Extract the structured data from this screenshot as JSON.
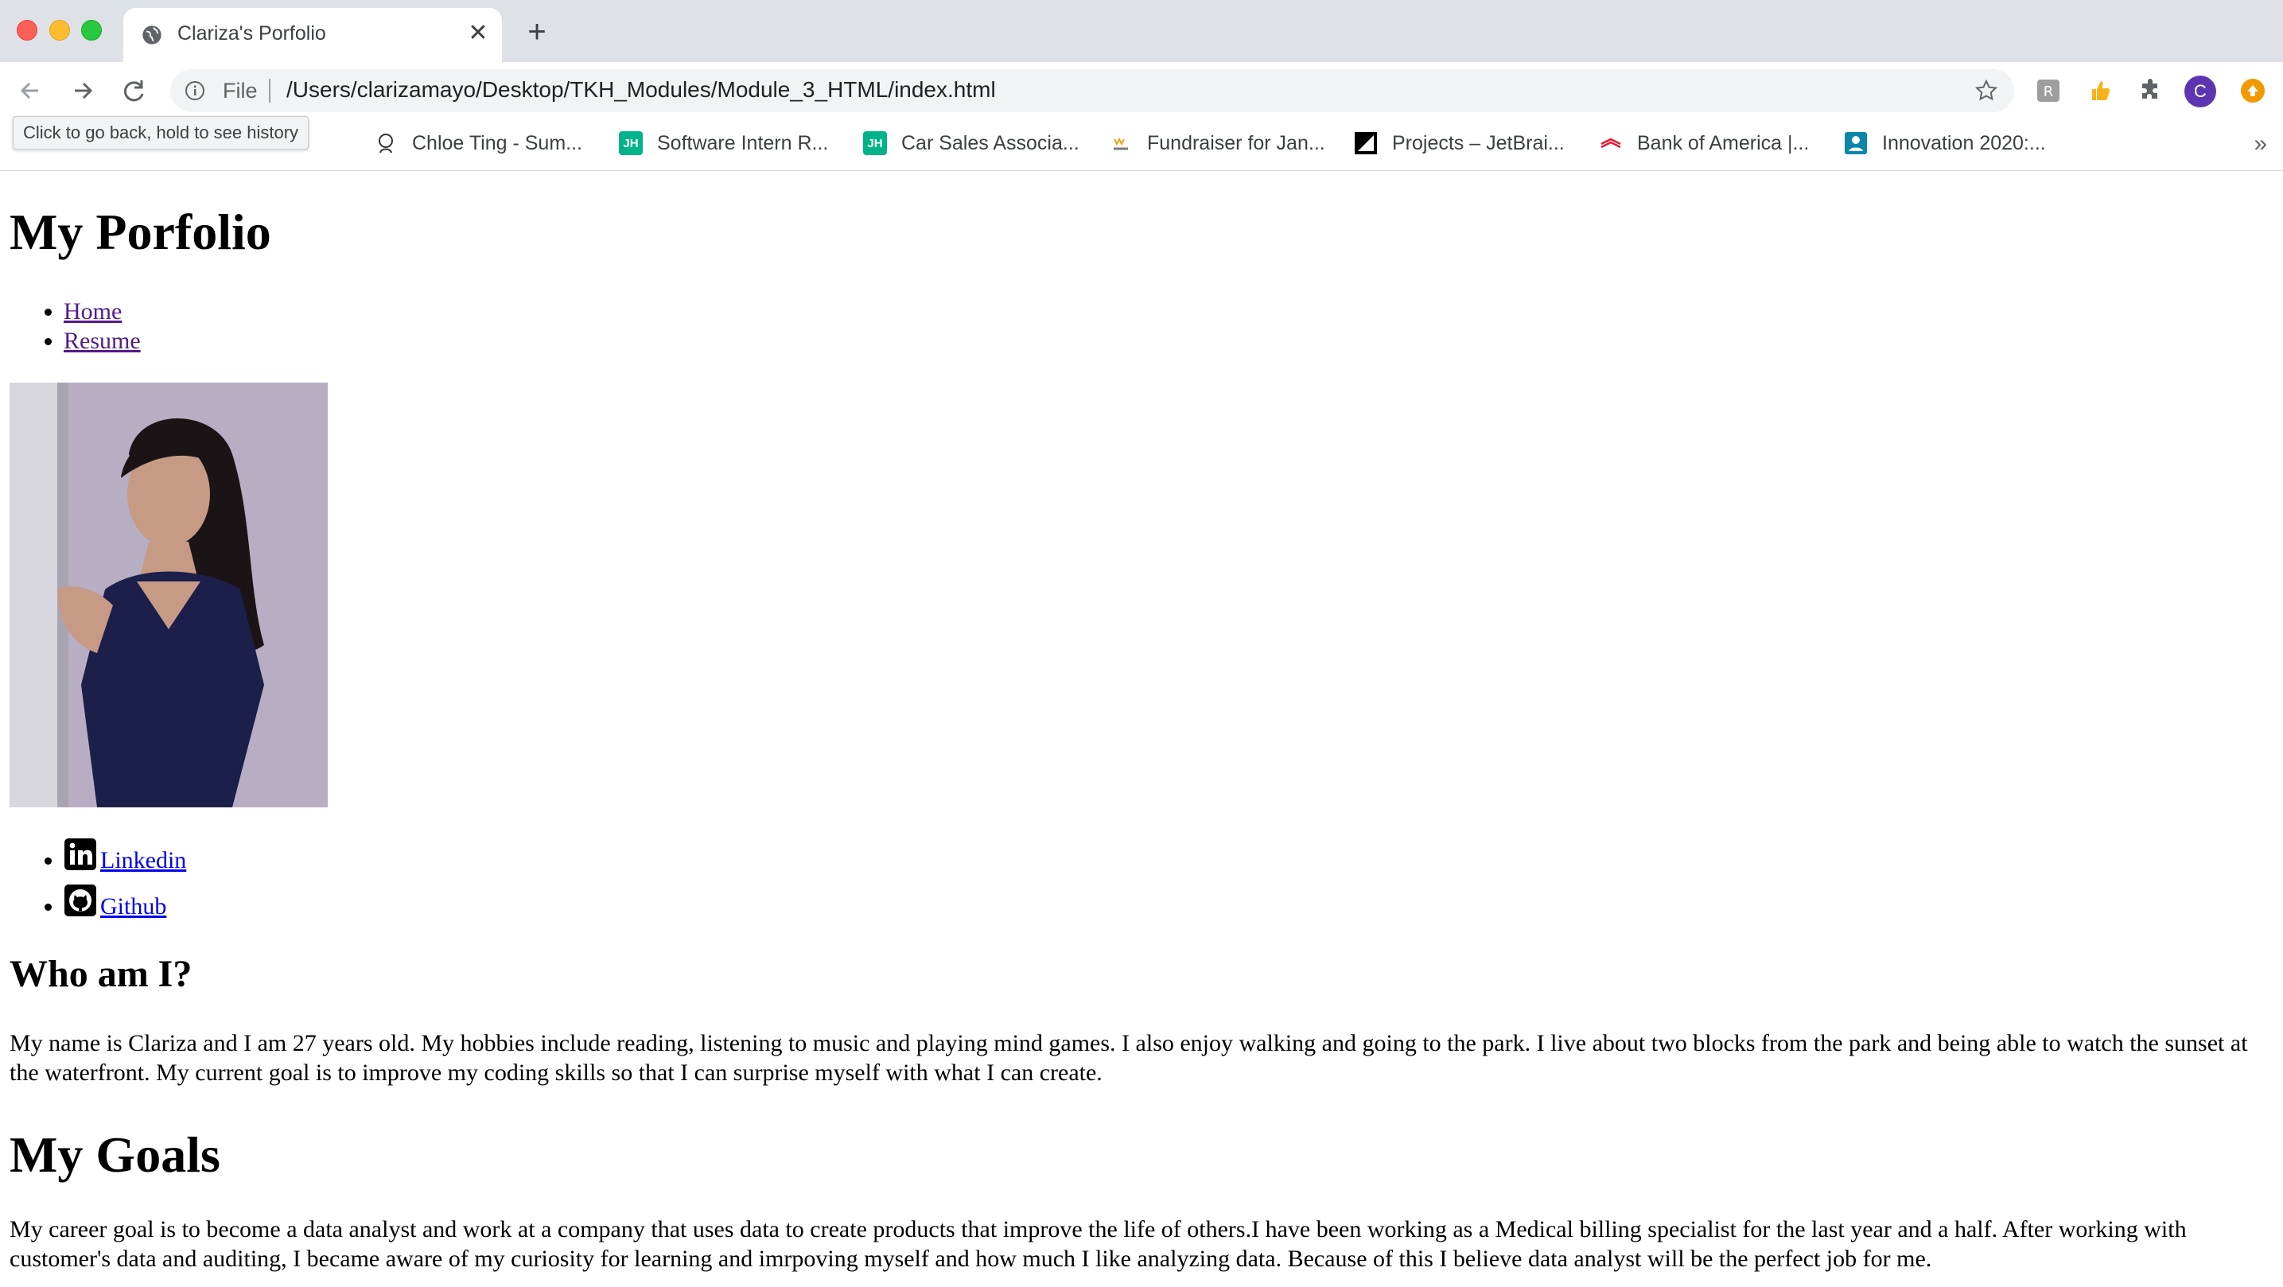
{
  "browser": {
    "tab_title": "Clariza's Porfolio",
    "tab_close": "✕",
    "new_tab": "+",
    "address_scheme": "File",
    "address_url": "/Users/clarizamayo/Desktop/TKH_Modules/Module_3_HTML/index.html",
    "profile_initial": "C",
    "tooltip": "Click to go back, hold to see history",
    "bookmarks": [
      {
        "label": "Chloe Ting - Sum...",
        "icon": "chloe-ting-icon",
        "color": "#ffffff"
      },
      {
        "label": "Software Intern R...",
        "icon": "jh",
        "color": "#00b388"
      },
      {
        "label": "Car Sales Associa...",
        "icon": "jh",
        "color": "#00b388"
      },
      {
        "label": "Fundraiser for Jan...",
        "icon": "gofundme-icon",
        "color": "#ffffff"
      },
      {
        "label": "Projects – JetBrai...",
        "icon": "jetbrains-icon",
        "color": "#000000"
      },
      {
        "label": "Bank of America |...",
        "icon": "bofa-icon",
        "color": "#ffffff"
      },
      {
        "label": "Innovation 2020:...",
        "icon": "innovation-icon",
        "color": "#0b86a8"
      }
    ],
    "bookmarks_more": "»",
    "jh_text": "JH"
  },
  "page": {
    "title": "My Porfolio",
    "nav": [
      "Home",
      "Resume"
    ],
    "social": [
      "Linkedin",
      "Github"
    ],
    "who_heading": "Who am I?",
    "who_text": "My name is Clariza and I am 27 years old. My hobbies include reading, listening to music and playing mind games. I also enjoy walking and going to the park. I live about two blocks from the park and being able to watch the sunset at the waterfront. My current goal is to improve my coding skills so that I can surprise myself with what I can create.",
    "goals_heading": "My Goals",
    "goals_text": "My career goal is to become a data analyst and work at a company that uses data to create products that improve the life of others.I have been working as a Medical billing specialist for the last year and a half. After working with customer's data and auditing, I became aware of my curiosity for learning and imrpoving myself and how much I like analyzing data. Because of this I believe data analyst will be the perfect job for me."
  }
}
